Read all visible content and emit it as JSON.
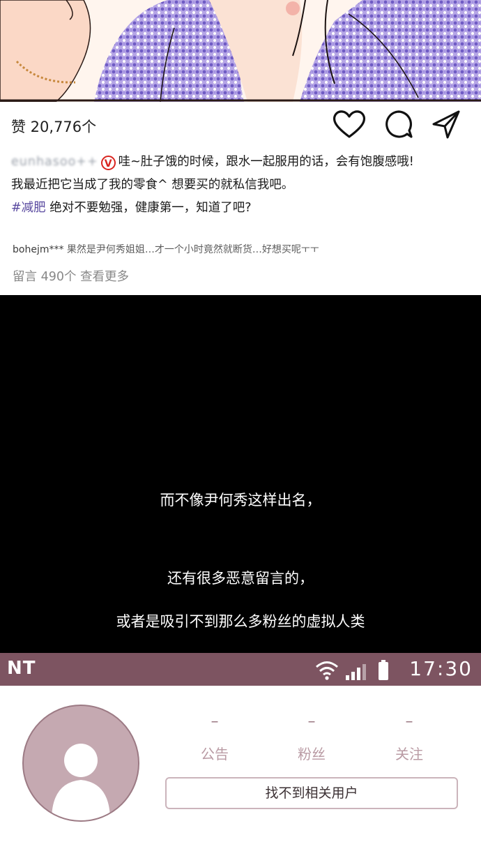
{
  "post": {
    "likes": "赞 20,776个",
    "username": "eunhasoo++",
    "verified_badge": "V",
    "caption_line1": "哇~肚子饿的时候，跟水一起服用的话，会有饱腹感哦!",
    "caption_line2": "我最近把它当成了我的零食^ 想要买的就私信我吧。",
    "hashtag": "#减肥",
    "caption_line3": " 绝对不要勉强，健康第一，知道了吧?",
    "comment_user": "bohejm***",
    "comment_text": " 果然是尹何秀姐姐…才一个小时竟然就断货…好想买呢ㅜㅜ",
    "view_more": "留言 490个 查看更多",
    "icons": [
      "heart-icon",
      "comment-icon",
      "send-icon"
    ]
  },
  "narration": {
    "line1": "而不像尹何秀这样出名，",
    "line2": "还有很多恶意留言的，",
    "line3": "或者是吸引不到那么多粉丝的虚拟人类"
  },
  "status_bar": {
    "carrier": "NT",
    "time": "17:30",
    "icons": [
      "wifi-icon",
      "signal-icon",
      "battery-icon"
    ]
  },
  "profile": {
    "stats": [
      {
        "value": "–",
        "label": "公告"
      },
      {
        "value": "–",
        "label": "粉丝"
      },
      {
        "value": "–",
        "label": "关注"
      }
    ],
    "user_button": "找不到相关用户"
  },
  "colors": {
    "status_bar": "#7d5461",
    "avatar": "#c5a9b1",
    "accent_text": "#b99aa3"
  }
}
